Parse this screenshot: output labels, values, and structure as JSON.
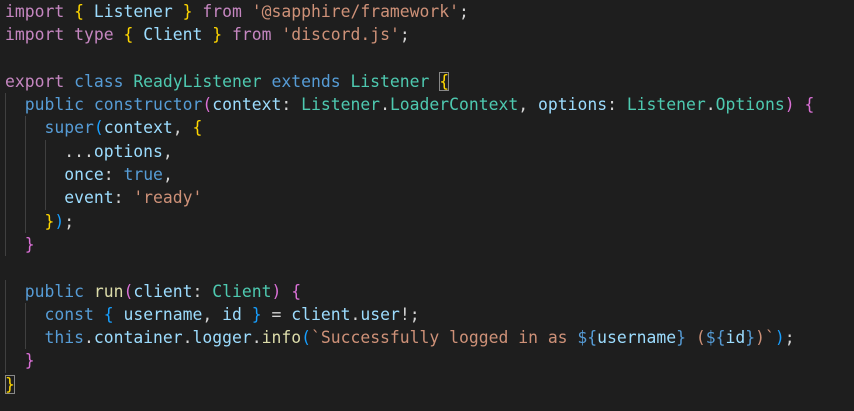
{
  "editor": {
    "colors": {
      "background": "#1e1e1e",
      "keyword": "#c586c0",
      "storage": "#569cd6",
      "className": "#4ec9b0",
      "function": "#dcdcaa",
      "variable": "#9cdcfe",
      "string": "#ce9178",
      "text": "#d4d4d4",
      "bracket1": "#ffd700",
      "bracket2": "#da70d6",
      "bracket3": "#179fff",
      "indentGuide": "#404040"
    },
    "lines": [
      {
        "indent": 0,
        "tokens": [
          {
            "t": "import",
            "c": "keyword"
          },
          {
            "t": " ",
            "c": "text"
          },
          {
            "t": "{",
            "c": "bracket1"
          },
          {
            "t": " ",
            "c": "text"
          },
          {
            "t": "Listener",
            "c": "variable"
          },
          {
            "t": " ",
            "c": "text"
          },
          {
            "t": "}",
            "c": "bracket1"
          },
          {
            "t": " ",
            "c": "text"
          },
          {
            "t": "from",
            "c": "keyword"
          },
          {
            "t": " ",
            "c": "text"
          },
          {
            "t": "'@sapphire/framework'",
            "c": "string"
          },
          {
            "t": ";",
            "c": "text"
          }
        ]
      },
      {
        "indent": 0,
        "tokens": [
          {
            "t": "import",
            "c": "keyword"
          },
          {
            "t": " ",
            "c": "text"
          },
          {
            "t": "type",
            "c": "keyword"
          },
          {
            "t": " ",
            "c": "text"
          },
          {
            "t": "{",
            "c": "bracket1"
          },
          {
            "t": " ",
            "c": "text"
          },
          {
            "t": "Client",
            "c": "variable"
          },
          {
            "t": " ",
            "c": "text"
          },
          {
            "t": "}",
            "c": "bracket1"
          },
          {
            "t": " ",
            "c": "text"
          },
          {
            "t": "from",
            "c": "keyword"
          },
          {
            "t": " ",
            "c": "text"
          },
          {
            "t": "'discord.js'",
            "c": "string"
          },
          {
            "t": ";",
            "c": "text"
          }
        ]
      },
      {
        "indent": 0,
        "tokens": []
      },
      {
        "indent": 0,
        "tokens": [
          {
            "t": "export",
            "c": "keyword"
          },
          {
            "t": " ",
            "c": "text"
          },
          {
            "t": "class",
            "c": "storage"
          },
          {
            "t": " ",
            "c": "text"
          },
          {
            "t": "ReadyListener",
            "c": "className"
          },
          {
            "t": " ",
            "c": "text"
          },
          {
            "t": "extends",
            "c": "storage"
          },
          {
            "t": " ",
            "c": "text"
          },
          {
            "t": "Listener",
            "c": "className"
          },
          {
            "t": " ",
            "c": "text"
          },
          {
            "t": "{",
            "c": "bracket1",
            "match": true
          }
        ]
      },
      {
        "indent": 1,
        "tokens": [
          {
            "t": "public",
            "c": "storage"
          },
          {
            "t": " ",
            "c": "text"
          },
          {
            "t": "constructor",
            "c": "storage"
          },
          {
            "t": "(",
            "c": "bracket2"
          },
          {
            "t": "context",
            "c": "variable"
          },
          {
            "t": ": ",
            "c": "text"
          },
          {
            "t": "Listener",
            "c": "className"
          },
          {
            "t": ".",
            "c": "text"
          },
          {
            "t": "LoaderContext",
            "c": "className"
          },
          {
            "t": ", ",
            "c": "text"
          },
          {
            "t": "options",
            "c": "variable"
          },
          {
            "t": ": ",
            "c": "text"
          },
          {
            "t": "Listener",
            "c": "className"
          },
          {
            "t": ".",
            "c": "text"
          },
          {
            "t": "Options",
            "c": "className"
          },
          {
            "t": ")",
            "c": "bracket2"
          },
          {
            "t": " ",
            "c": "text"
          },
          {
            "t": "{",
            "c": "bracket2"
          }
        ]
      },
      {
        "indent": 2,
        "tokens": [
          {
            "t": "super",
            "c": "storage"
          },
          {
            "t": "(",
            "c": "bracket3"
          },
          {
            "t": "context",
            "c": "variable"
          },
          {
            "t": ", ",
            "c": "text"
          },
          {
            "t": "{",
            "c": "bracket1"
          }
        ]
      },
      {
        "indent": 3,
        "tokens": [
          {
            "t": "...",
            "c": "text"
          },
          {
            "t": "options",
            "c": "variable"
          },
          {
            "t": ",",
            "c": "text"
          }
        ]
      },
      {
        "indent": 3,
        "tokens": [
          {
            "t": "once",
            "c": "variable"
          },
          {
            "t": ": ",
            "c": "text"
          },
          {
            "t": "true",
            "c": "storage"
          },
          {
            "t": ",",
            "c": "text"
          }
        ]
      },
      {
        "indent": 3,
        "tokens": [
          {
            "t": "event",
            "c": "variable"
          },
          {
            "t": ": ",
            "c": "text"
          },
          {
            "t": "'ready'",
            "c": "string"
          }
        ]
      },
      {
        "indent": 2,
        "tokens": [
          {
            "t": "}",
            "c": "bracket1"
          },
          {
            "t": ")",
            "c": "bracket3"
          },
          {
            "t": ";",
            "c": "text"
          }
        ]
      },
      {
        "indent": 1,
        "tokens": [
          {
            "t": "}",
            "c": "bracket2"
          }
        ]
      },
      {
        "indent": 0,
        "tokens": []
      },
      {
        "indent": 1,
        "tokens": [
          {
            "t": "public",
            "c": "storage"
          },
          {
            "t": " ",
            "c": "text"
          },
          {
            "t": "run",
            "c": "function"
          },
          {
            "t": "(",
            "c": "bracket2"
          },
          {
            "t": "client",
            "c": "variable"
          },
          {
            "t": ": ",
            "c": "text"
          },
          {
            "t": "Client",
            "c": "className"
          },
          {
            "t": ")",
            "c": "bracket2"
          },
          {
            "t": " ",
            "c": "text"
          },
          {
            "t": "{",
            "c": "bracket2"
          }
        ]
      },
      {
        "indent": 2,
        "tokens": [
          {
            "t": "const",
            "c": "storage"
          },
          {
            "t": " ",
            "c": "text"
          },
          {
            "t": "{",
            "c": "bracket3"
          },
          {
            "t": " ",
            "c": "text"
          },
          {
            "t": "username",
            "c": "variable"
          },
          {
            "t": ", ",
            "c": "text"
          },
          {
            "t": "id",
            "c": "variable"
          },
          {
            "t": " ",
            "c": "text"
          },
          {
            "t": "}",
            "c": "bracket3"
          },
          {
            "t": " = ",
            "c": "text"
          },
          {
            "t": "client",
            "c": "variable"
          },
          {
            "t": ".",
            "c": "text"
          },
          {
            "t": "user",
            "c": "variable"
          },
          {
            "t": "!;",
            "c": "text"
          }
        ]
      },
      {
        "indent": 2,
        "tokens": [
          {
            "t": "this",
            "c": "storage"
          },
          {
            "t": ".",
            "c": "text"
          },
          {
            "t": "container",
            "c": "variable"
          },
          {
            "t": ".",
            "c": "text"
          },
          {
            "t": "logger",
            "c": "variable"
          },
          {
            "t": ".",
            "c": "text"
          },
          {
            "t": "info",
            "c": "function"
          },
          {
            "t": "(",
            "c": "bracket3"
          },
          {
            "t": "`Successfully logged in as ",
            "c": "string"
          },
          {
            "t": "${",
            "c": "storage"
          },
          {
            "t": "username",
            "c": "variable"
          },
          {
            "t": "}",
            "c": "storage"
          },
          {
            "t": " (",
            "c": "string"
          },
          {
            "t": "${",
            "c": "storage"
          },
          {
            "t": "id",
            "c": "variable"
          },
          {
            "t": "}",
            "c": "storage"
          },
          {
            "t": ")`",
            "c": "string"
          },
          {
            "t": ")",
            "c": "bracket3"
          },
          {
            "t": ";",
            "c": "text"
          }
        ]
      },
      {
        "indent": 1,
        "tokens": [
          {
            "t": "}",
            "c": "bracket2"
          }
        ]
      },
      {
        "indent": 0,
        "tokens": [
          {
            "t": "}",
            "c": "bracket1",
            "match": true
          }
        ]
      }
    ]
  }
}
